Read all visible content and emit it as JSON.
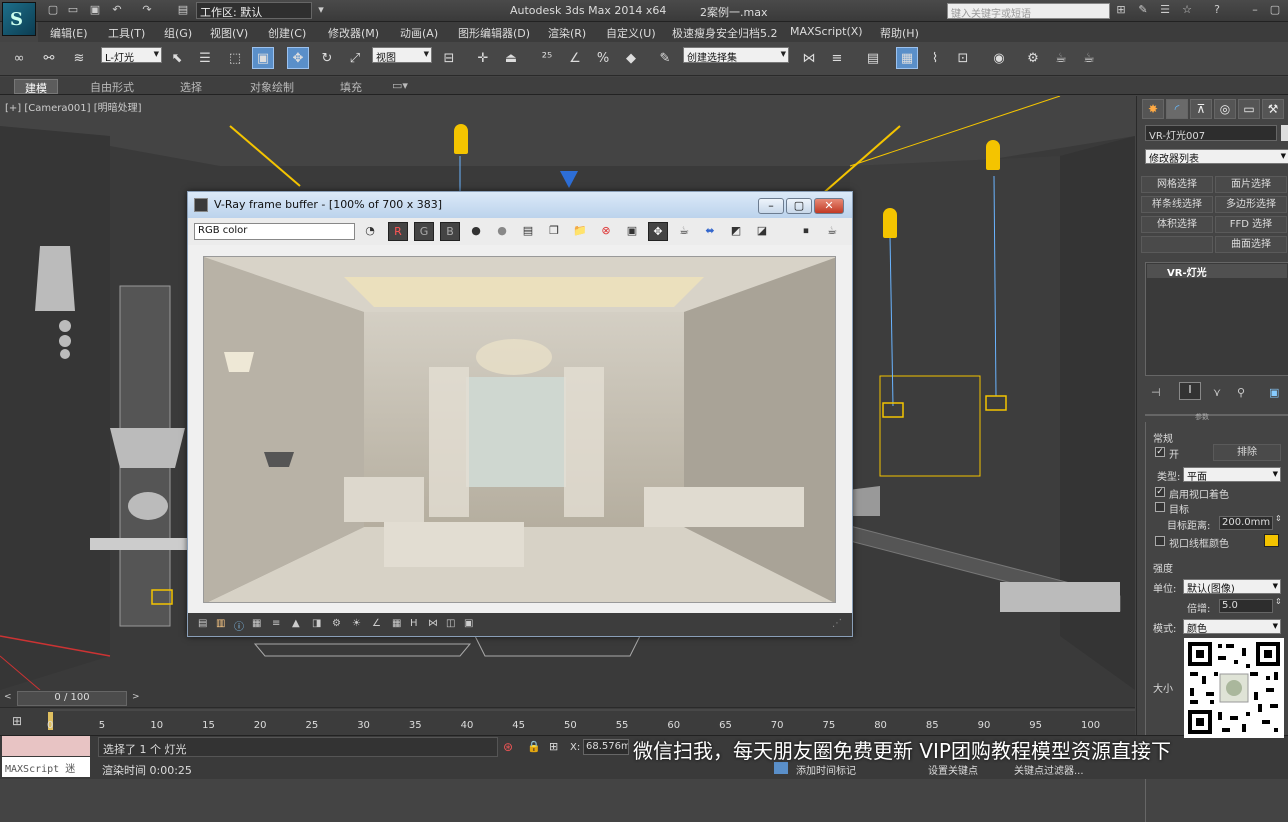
{
  "titlebar": {
    "logo_letter": "S",
    "workspace": "工作区: 默认",
    "app_title": "Autodesk 3ds Max  2014 x64",
    "file_title": "2案例一.max",
    "search_placeholder": "键入关键字或短语"
  },
  "menu": [
    "编辑(E)",
    "工具(T)",
    "组(G)",
    "视图(V)",
    "创建(C)",
    "修改器(M)",
    "动画(A)",
    "图形编辑器(D)",
    "渲染(R)",
    "自定义(U)",
    "极速瘦身安全归档5.2",
    "MAXScript(X)",
    "帮助(H)"
  ],
  "toolbar": {
    "filter_value": "L-灯光",
    "refcoord_value": "视图",
    "selset_value": "创建选择集"
  },
  "ribbon_tabs": [
    "建模",
    "自由形式",
    "选择",
    "对象绘制",
    "填充"
  ],
  "viewport": {
    "label_plus": "[+]",
    "label_camera": "[Camera001]",
    "label_shading": "[明暗处理]"
  },
  "vray": {
    "title": "V-Ray frame buffer - [100% of 700 x 383]",
    "channel": "RGB color",
    "btn_r": "R",
    "btn_g": "G",
    "btn_b": "B"
  },
  "command_panel": {
    "object_name": "VR-灯光007",
    "modifier_list": "修改器列表",
    "mod_buttons": [
      "网格选择",
      "面片选择",
      "样条线选择",
      "多边形选择",
      "体积选择",
      "FFD 选择",
      "",
      "曲面选择"
    ],
    "stack_item": "VR-灯光",
    "rollout_title": "参数",
    "general_label": "常规",
    "on_label": "开",
    "exclude_btn": "排除",
    "type_label": "类型:",
    "type_value": "平面",
    "viewport_shading_label": "启用视口着色",
    "target_label": "目标",
    "target_dist_label": "目标距离:",
    "target_dist_value": "200.0mm",
    "wire_color_label": "视口线框颜色",
    "intensity_label": "强度",
    "units_label": "单位:",
    "units_value": "默认(图像)",
    "multiplier_label": "倍增:",
    "multiplier_value": "5.0",
    "mode_label": "模式:",
    "mode_value": "颜色",
    "size_label": "大小"
  },
  "timeline": {
    "frame_counter": "0 / 100",
    "ticks": [
      "0",
      "5",
      "10",
      "15",
      "20",
      "25",
      "30",
      "35",
      "40",
      "45",
      "50",
      "55",
      "60",
      "65",
      "70",
      "75",
      "80",
      "85",
      "90",
      "95",
      "100"
    ]
  },
  "status": {
    "maxscript_label": "MAXScript 迷",
    "selection_text": "选择了 1 个 灯光",
    "render_time": "渲染时间 0:00:25",
    "x_label": "X:",
    "x_value": "68.576mm",
    "add_time_tag": "添加时间标记",
    "key_filter_1": "设置关键点",
    "key_filter_2": "关键点过滤器..."
  },
  "watermark_text": "微信扫我，每天朋友圈免费更新 VIP团购教程模型资源直接下",
  "colors": {
    "accent_blue": "#5a8fc9",
    "wire_yellow": "#f4c400",
    "light_blue": "#6ab4ff",
    "panel_bg": "#444444"
  }
}
